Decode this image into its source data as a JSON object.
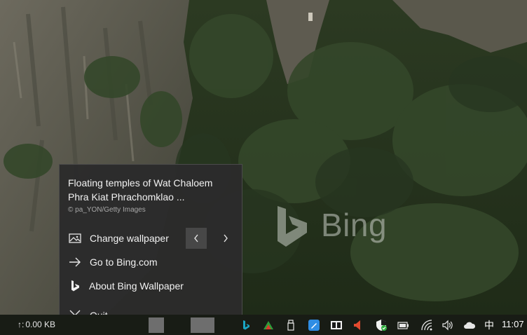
{
  "popup": {
    "title": "Floating temples of Wat Chaloem Phra Kiat Phrachomklao ...",
    "credit": "© pa_YON/Getty Images",
    "items": [
      {
        "label": "Change wallpaper",
        "icon": "image-icon"
      },
      {
        "label": "Go to Bing.com",
        "icon": "arrow-right-icon"
      },
      {
        "label": "About Bing Wallpaper",
        "icon": "bing-logo-icon"
      },
      {
        "label": "Quit",
        "icon": "close-icon"
      }
    ]
  },
  "watermark": {
    "text": "Bing"
  },
  "taskbar": {
    "net_speed": "0.00 KB",
    "ime": "中",
    "clock": "11:07"
  },
  "colors": {
    "menu_bg": "#2b2b2b",
    "taskbar_bg": "#181c15",
    "bing_teal": "#1aa6c4"
  }
}
